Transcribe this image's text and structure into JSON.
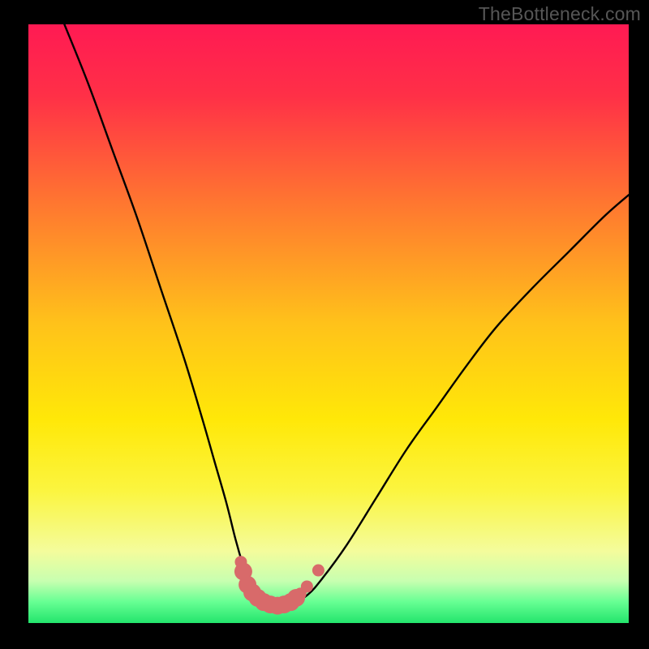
{
  "watermark": "TheBottleneck.com",
  "chart_data": {
    "type": "line",
    "title": "",
    "xlabel": "",
    "ylabel": "",
    "xlim": [
      0,
      100
    ],
    "ylim": [
      0,
      100
    ],
    "background_gradient": {
      "stops": [
        {
          "offset": 0.0,
          "color": "#ff1a53"
        },
        {
          "offset": 0.12,
          "color": "#ff3047"
        },
        {
          "offset": 0.3,
          "color": "#ff7730"
        },
        {
          "offset": 0.5,
          "color": "#ffc21a"
        },
        {
          "offset": 0.66,
          "color": "#ffe808"
        },
        {
          "offset": 0.78,
          "color": "#fbf540"
        },
        {
          "offset": 0.88,
          "color": "#f4fc9c"
        },
        {
          "offset": 0.93,
          "color": "#c7ffb0"
        },
        {
          "offset": 0.965,
          "color": "#66ff93"
        },
        {
          "offset": 1.0,
          "color": "#23e46c"
        }
      ]
    },
    "series": [
      {
        "name": "bottleneck-curve",
        "color": "#000000",
        "x": [
          6,
          10,
          14,
          18,
          22,
          26,
          29,
          31,
          33,
          34.5,
          35.8,
          37,
          38,
          39.5,
          41,
          42.5,
          44,
          46.5,
          49,
          53,
          58,
          63,
          68,
          73,
          78,
          84,
          90,
          96,
          100
        ],
        "y": [
          100,
          90,
          79,
          68,
          56,
          44,
          34,
          27,
          20,
          14,
          9.5,
          6,
          4.5,
          3.3,
          2.8,
          2.8,
          3.3,
          4.7,
          7.5,
          13,
          21,
          29,
          36,
          43,
          49.5,
          56,
          62,
          68,
          71.5
        ]
      },
      {
        "name": "highlight-band",
        "type": "scatter",
        "color": "#d86a6a",
        "marker_size_large": 22,
        "marker_size_small": 15,
        "points": [
          {
            "x": 35.4,
            "y": 10.2,
            "size": "small"
          },
          {
            "x": 35.8,
            "y": 8.6,
            "size": "large"
          },
          {
            "x": 36.5,
            "y": 6.4,
            "size": "large"
          },
          {
            "x": 37.3,
            "y": 5.1,
            "size": "large"
          },
          {
            "x": 38.2,
            "y": 4.2,
            "size": "large"
          },
          {
            "x": 39.2,
            "y": 3.5,
            "size": "large"
          },
          {
            "x": 40.3,
            "y": 3.1,
            "size": "large"
          },
          {
            "x": 41.5,
            "y": 2.9,
            "size": "large"
          },
          {
            "x": 42.6,
            "y": 3.1,
            "size": "large"
          },
          {
            "x": 43.7,
            "y": 3.5,
            "size": "large"
          },
          {
            "x": 44.6,
            "y": 4.2,
            "size": "large"
          },
          {
            "x": 45.3,
            "y": 4.9,
            "size": "small"
          },
          {
            "x": 46.4,
            "y": 6.1,
            "size": "small"
          },
          {
            "x": 48.3,
            "y": 8.8,
            "size": "small"
          }
        ]
      }
    ]
  }
}
